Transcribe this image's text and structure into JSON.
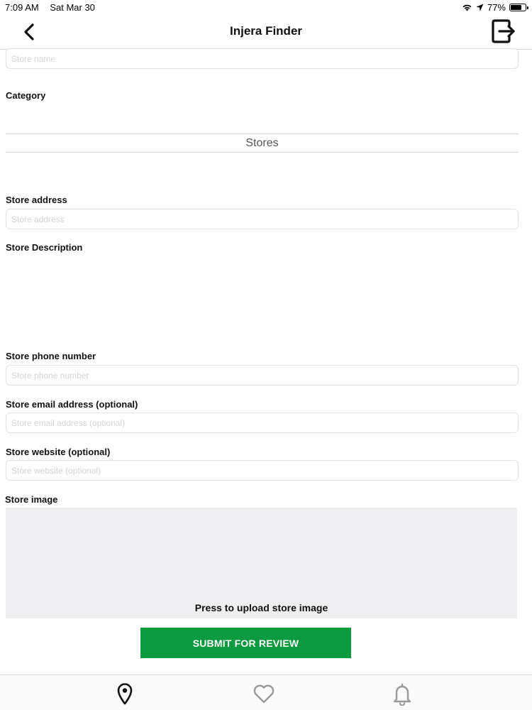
{
  "status_bar": {
    "time": "7:09 AM",
    "date": "Sat Mar 30",
    "battery": "77%",
    "battery_level": 0.77
  },
  "nav": {
    "title": "Injera Finder"
  },
  "form": {
    "store_name": {
      "placeholder": "Store name",
      "value": ""
    },
    "category": {
      "label": "Category",
      "selected": "Stores"
    },
    "store_address": {
      "label": "Store address",
      "placeholder": "Store address",
      "value": ""
    },
    "store_description": {
      "label": "Store Description",
      "value": ""
    },
    "store_phone": {
      "label": "Store phone number",
      "placeholder": "Store phone number",
      "value": ""
    },
    "store_email": {
      "label": "Store email address (optional)",
      "placeholder": "Store email address (optional)",
      "value": ""
    },
    "store_website": {
      "label": "Store website (optional)",
      "placeholder": "Store website (optional)",
      "value": ""
    },
    "store_image": {
      "label": "Store image",
      "upload_text": "Press to upload store image"
    },
    "submit_label": "SUBMIT FOR REVIEW"
  },
  "tabs": [
    {
      "icon": "map-pin-icon",
      "active": true
    },
    {
      "icon": "heart-icon",
      "active": false
    },
    {
      "icon": "bell-icon",
      "active": false
    }
  ],
  "colors": {
    "submit_button": "#0c9a3e",
    "upload_area": "#efeff2"
  }
}
